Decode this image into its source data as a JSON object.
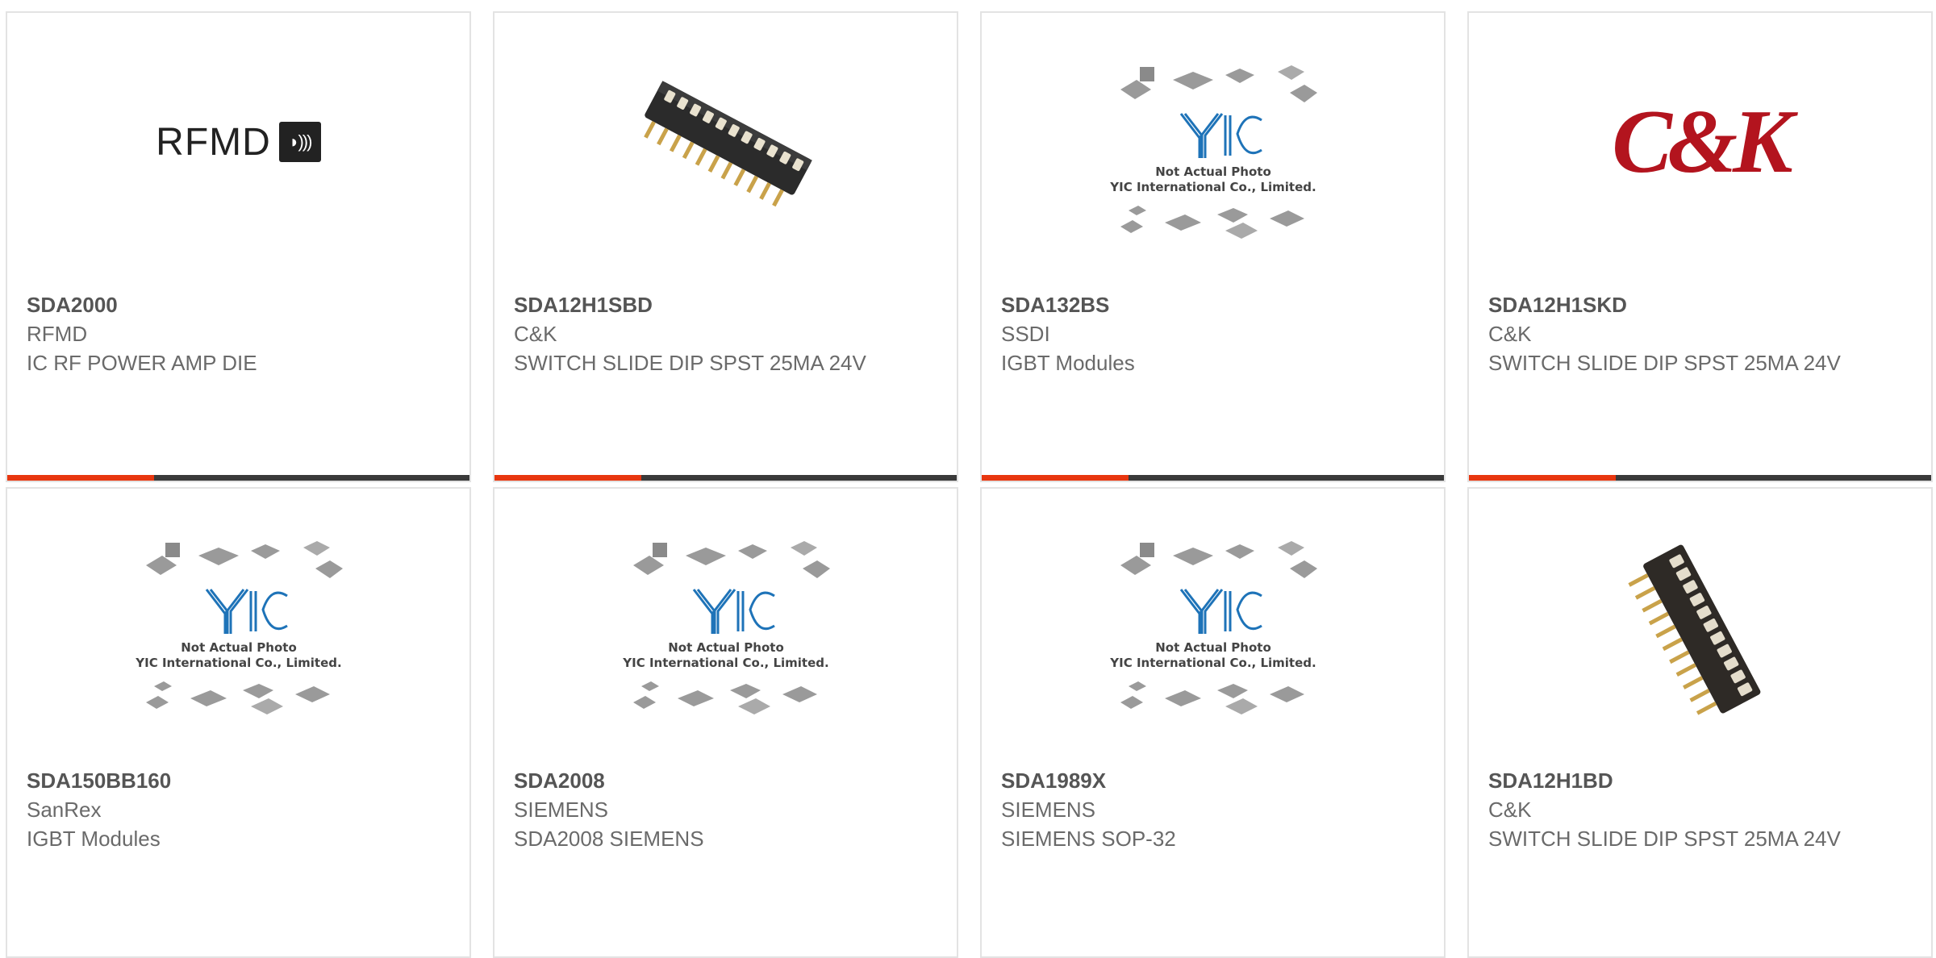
{
  "cards": [
    {
      "part": "SDA2000",
      "manufacturer": "RFMD",
      "description": "IC RF POWER AMP DIE",
      "image": "rfmd-logo",
      "logo_text": "RFMD"
    },
    {
      "part": "SDA12H1SBD",
      "manufacturer": "C&K",
      "description": "SWITCH SLIDE DIP SPST 25MA 24V",
      "image": "dip-switch-photo"
    },
    {
      "part": "SDA132BS",
      "manufacturer": "SSDI",
      "description": "IGBT Modules",
      "image": "yic-placeholder"
    },
    {
      "part": "SDA12H1SKD",
      "manufacturer": "C&K",
      "description": "SWITCH SLIDE DIP SPST 25MA 24V",
      "image": "ck-logo",
      "logo_text": "C&K"
    },
    {
      "part": "SDA150BB160",
      "manufacturer": "SanRex",
      "description": "IGBT Modules",
      "image": "yic-placeholder"
    },
    {
      "part": "SDA2008",
      "manufacturer": "SIEMENS",
      "description": "SDA2008 SIEMENS",
      "image": "yic-placeholder"
    },
    {
      "part": "SDA1989X",
      "manufacturer": "SIEMENS",
      "description": "SIEMENS SOP-32",
      "image": "yic-placeholder"
    },
    {
      "part": "SDA12H1BD",
      "manufacturer": "C&K",
      "description": "SWITCH SLIDE DIP SPST 25MA 24V",
      "image": "dip-switch-photo-2"
    }
  ],
  "placeholder": {
    "line1": "Not Actual Photo",
    "line2": "YIC International Co., Limited."
  },
  "colors": {
    "accent": "#e8360f",
    "bar": "#3a3a3a",
    "border": "#e3e3e3"
  }
}
